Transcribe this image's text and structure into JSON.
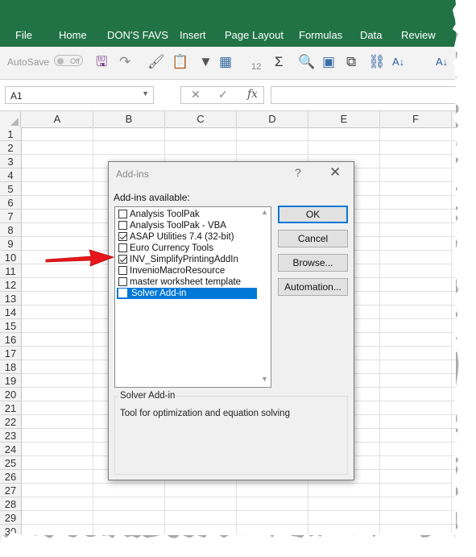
{
  "ribbon": {
    "tabs": [
      "File",
      "Home",
      "DON'S FAVS",
      "Insert",
      "Page Layout",
      "Formulas",
      "Data",
      "Review"
    ],
    "color": "#217346"
  },
  "quick_access": {
    "autosave_label": "AutoSave",
    "autosave_state": "Off",
    "icons": [
      "save-icon",
      "redo-icon",
      "format-painter-icon",
      "paste-icon",
      "filter-icon",
      "table-icon",
      "font-size-icon",
      "autosum-icon",
      "find-icon",
      "macro-icon",
      "copy-icon",
      "link-icon",
      "sort-az-icon",
      "sort-za-icon"
    ],
    "font_size_num": "12"
  },
  "formula_bar": {
    "name_box": "A1",
    "cancel": "✕",
    "enter": "✓",
    "fx": "fx",
    "value": ""
  },
  "grid": {
    "columns": [
      "A",
      "B",
      "C",
      "D",
      "E",
      "F"
    ],
    "rows": [
      "1",
      "2",
      "3",
      "4",
      "5",
      "6",
      "7",
      "8",
      "9",
      "10",
      "11",
      "12",
      "13",
      "14",
      "15",
      "16",
      "17",
      "18",
      "19",
      "20",
      "21",
      "22",
      "23",
      "24",
      "25",
      "26",
      "27",
      "28",
      "29",
      "30"
    ]
  },
  "dialog": {
    "title": "Add-ins",
    "help": "?",
    "close": "✕",
    "available_label": "Add-ins available:",
    "addins": [
      {
        "label": "Analysis ToolPak",
        "checked": false,
        "selected": false
      },
      {
        "label": "Analysis ToolPak - VBA",
        "checked": false,
        "selected": false
      },
      {
        "label": "ASAP Utilities 7.4 (32-bit)",
        "checked": true,
        "selected": false
      },
      {
        "label": "Euro Currency Tools",
        "checked": false,
        "selected": false
      },
      {
        "label": "INV_SimplifyPrintingAddIn",
        "checked": true,
        "selected": false
      },
      {
        "label": "InvenioMacroResource",
        "checked": false,
        "selected": false
      },
      {
        "label": "master worksheet template",
        "checked": false,
        "selected": false
      },
      {
        "label": "Solver Add-in",
        "checked": false,
        "selected": true
      }
    ],
    "buttons": {
      "ok": "OK",
      "cancel": "Cancel",
      "browse": "Browse...",
      "automation": "Automation..."
    },
    "description_title": "Solver Add-in",
    "description": "Tool for optimization and equation solving",
    "accent": "#0078d7"
  },
  "annotation": {
    "arrow_color": "#e8161b"
  }
}
